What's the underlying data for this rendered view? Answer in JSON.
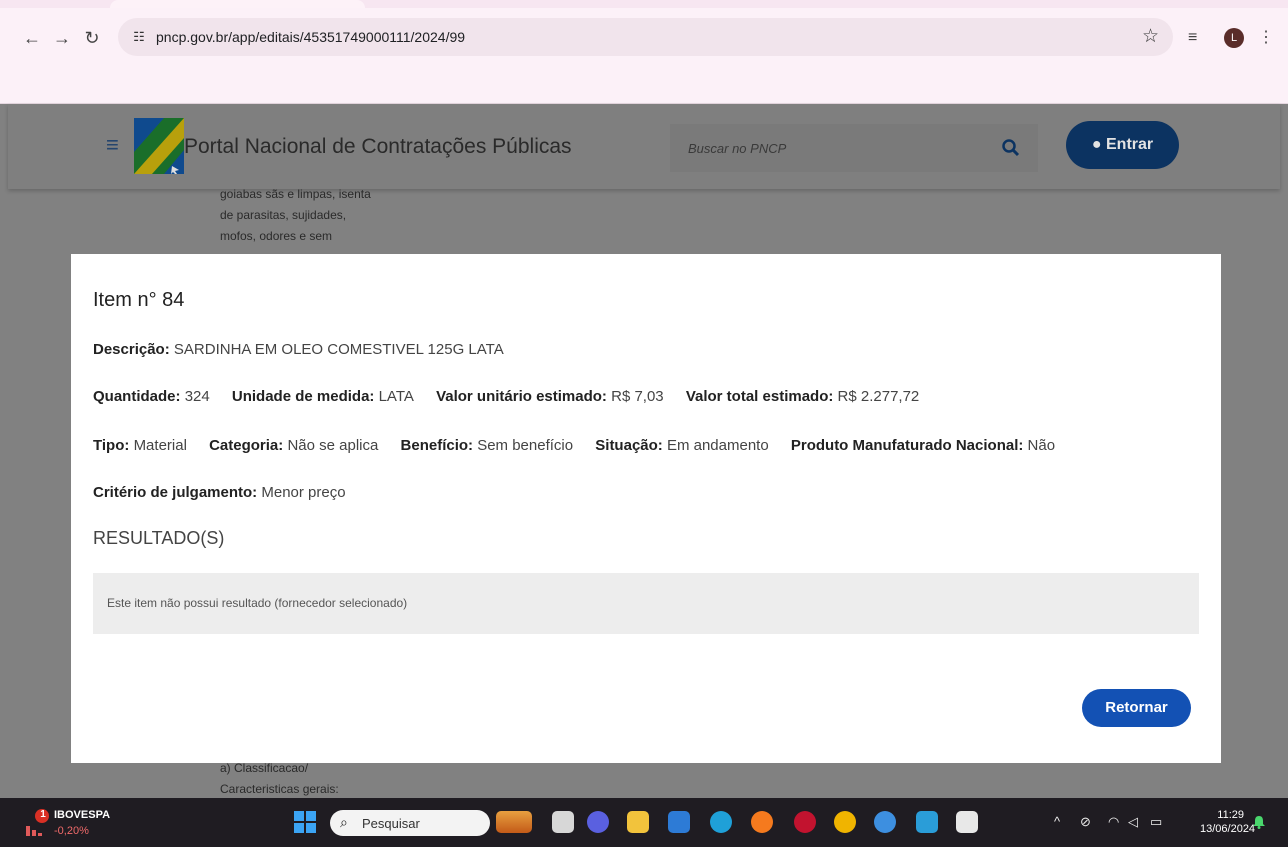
{
  "browser": {
    "url": "pncp.gov.br/app/editais/45351749000111/2024/99",
    "profile_initial": "L"
  },
  "site": {
    "title": "Portal Nacional de Contratações Públicas",
    "search_placeholder": "Buscar no PNCP",
    "login_label": "Entrar",
    "background_text_top": [
      "goiabas sãs e limpas, isenta",
      "de parasitas, sujidades,",
      "mofos, odores e sem"
    ],
    "background_text_bottom": [
      "a) Classificacao/",
      "Caracteristicas gerais:"
    ]
  },
  "modal": {
    "title": "Item n° 84",
    "descricao": {
      "label": "Descrição:",
      "value": "SARDINHA EM OLEO COMESTIVEL 125G LATA"
    },
    "quantidade": {
      "label": "Quantidade:",
      "value": "324"
    },
    "unidade": {
      "label": "Unidade de medida:",
      "value": "LATA"
    },
    "valor_unitario": {
      "label": "Valor unitário estimado:",
      "value": "R$ 7,03"
    },
    "valor_total": {
      "label": "Valor total estimado:",
      "value": "R$ 2.277,72"
    },
    "tipo": {
      "label": "Tipo:",
      "value": "Material"
    },
    "categoria": {
      "label": "Categoria:",
      "value": "Não se aplica"
    },
    "beneficio": {
      "label": "Benefício:",
      "value": "Sem benefício"
    },
    "situacao": {
      "label": "Situação:",
      "value": "Em andamento"
    },
    "produto_nacional": {
      "label": "Produto Manufaturado Nacional:",
      "value": "Não"
    },
    "criterio": {
      "label": "Critério de julgamento:",
      "value": "Menor preço"
    },
    "results_heading": "RESULTADO(S)",
    "no_result_text": "Este item não possui resultado (fornecedor selecionado)",
    "return_label": "Retornar"
  },
  "taskbar": {
    "widget_badge": "1",
    "widget_name": "IBOVESPA",
    "widget_change": "-0,20%",
    "search_label": "Pesquisar",
    "time": "11:29",
    "date": "13/06/2024"
  }
}
